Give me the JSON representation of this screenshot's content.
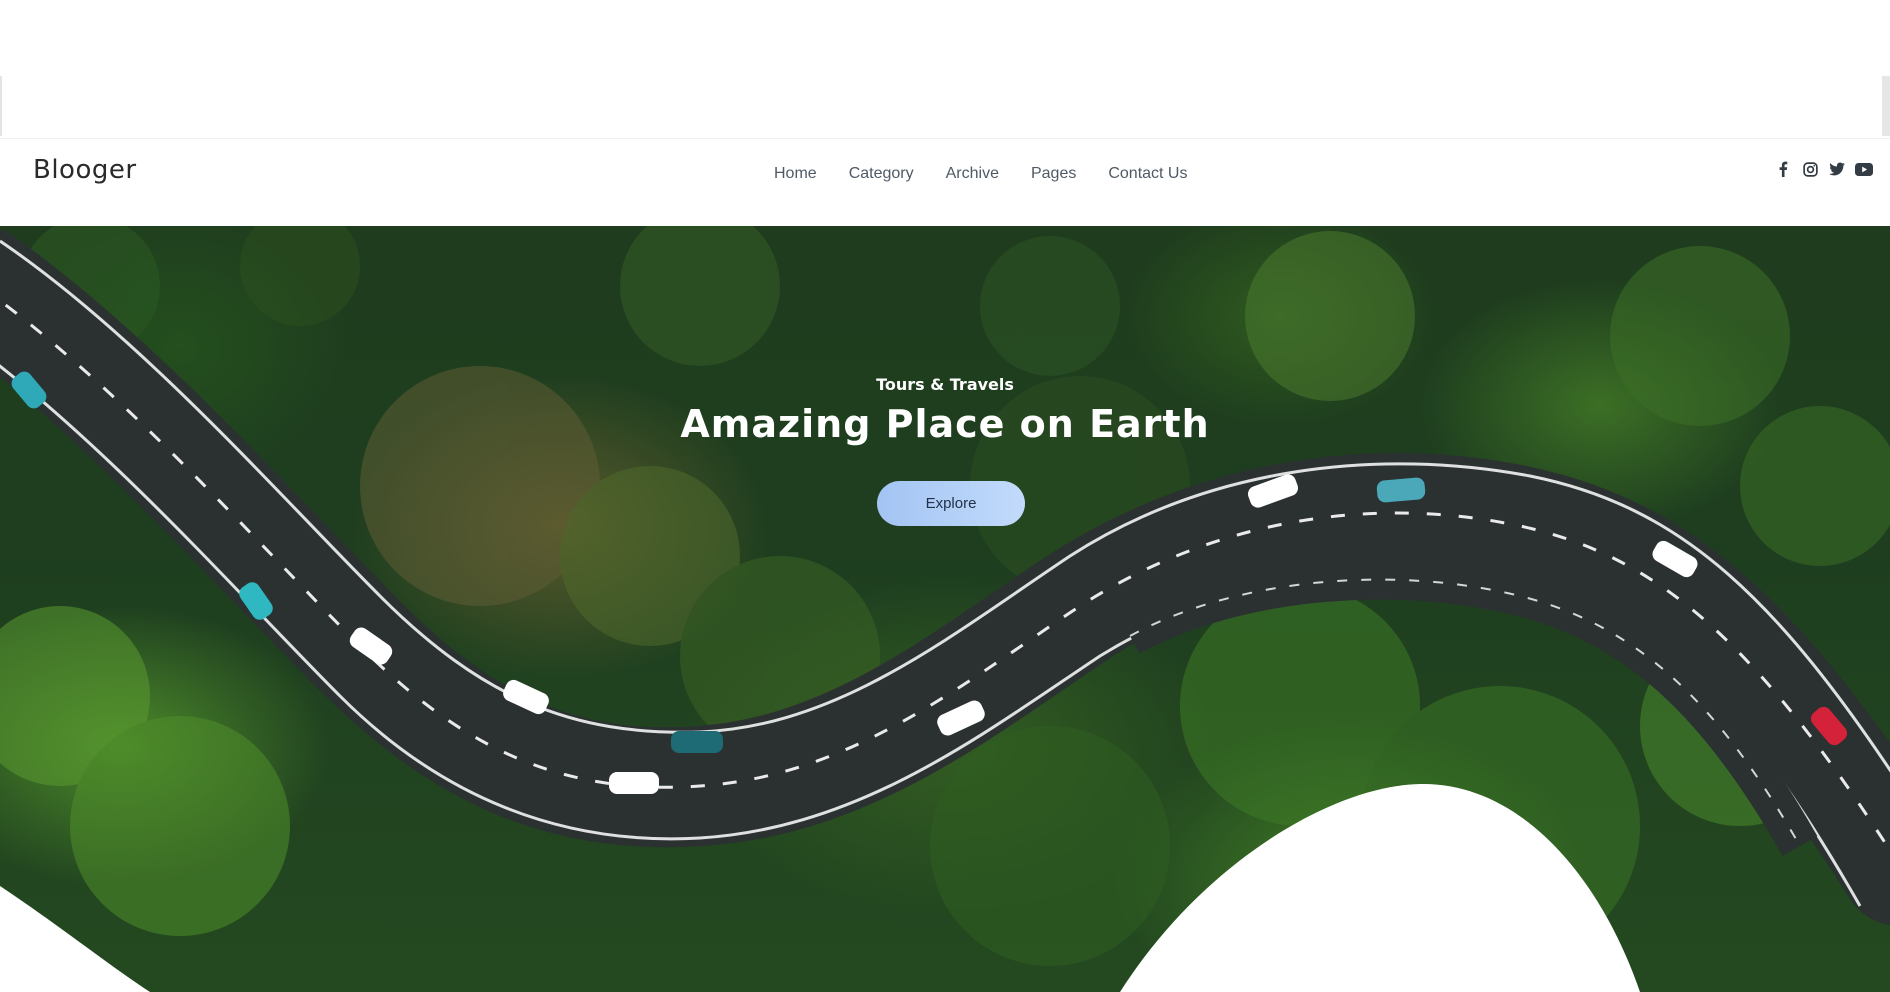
{
  "navbar": {
    "brand": "Blooger",
    "links": [
      {
        "label": "Home"
      },
      {
        "label": "Category"
      },
      {
        "label": "Archive"
      },
      {
        "label": "Pages"
      },
      {
        "label": "Contact Us"
      }
    ],
    "social_icons": [
      "facebook-icon",
      "instagram-icon",
      "twitter-icon",
      "youtube-icon"
    ]
  },
  "hero": {
    "eyebrow": "Tours & Travels",
    "title": "Amazing Place on Earth",
    "button_label": "Explore"
  },
  "colors": {
    "brand_text": "#2a2a2a",
    "nav_text": "#4f5a66",
    "button_gradient_start": "#a3c4f3",
    "button_gradient_end": "#c2dbfb",
    "forest": "#1f3d1e"
  }
}
